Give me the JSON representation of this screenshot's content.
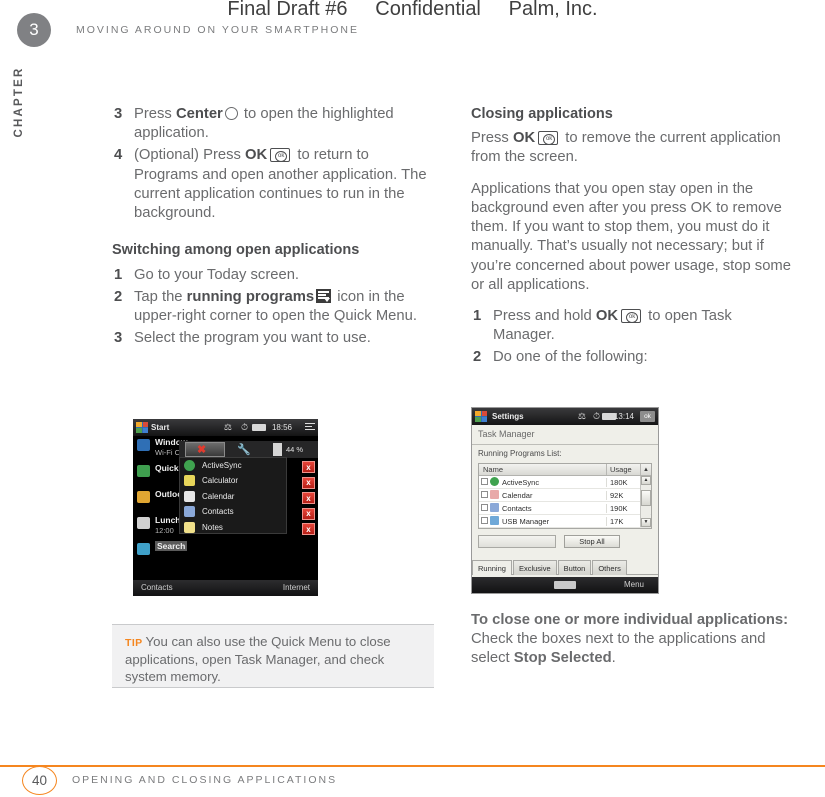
{
  "draft_header": "Final Draft #6     Confidential     Palm, Inc.",
  "chapter": {
    "number": "3",
    "word": "CHAPTER",
    "running_head": "MOVING AROUND ON YOUR SMARTPHONE"
  },
  "left_column": {
    "steps_top": [
      {
        "num": "3",
        "text_a": "Press ",
        "bold_a": "Center",
        "icon": "center-key-icon",
        "text_b": " to open the highlighted application."
      },
      {
        "num": "4",
        "text_a": "(Optional) Press ",
        "bold_a": "OK",
        "icon": "ok-key-icon",
        "text_b": " to return to Programs and open another application. The current application continues to run in the background."
      }
    ],
    "section_heading": "Switching among open applications",
    "steps_mid": [
      {
        "num": "1",
        "text": "Go to your Today screen."
      },
      {
        "num": "2",
        "text_a": "Tap the ",
        "bold_a": "running programs",
        "icon": "running-programs-icon",
        "text_b": " icon in the upper-right corner to open the Quick Menu."
      },
      {
        "num": "3",
        "text": "Select the program you want to use."
      }
    ],
    "tip": {
      "label": "TIP",
      "text": "You can also use the Quick Menu to close applications, open Task Manager, and check system memory."
    }
  },
  "right_column": {
    "section_heading": "Closing applications",
    "intro": {
      "text_a": "Press ",
      "bold_a": "OK",
      "icon": "ok-key-icon",
      "text_b": " to remove the current application from the screen."
    },
    "paragraph": "Applications that you open stay open in the background even after you press OK to remove them. If you want to stop them, you must do it manually. That’s usually not necessary; but if you’re concerned about power usage, stop some or all applications.",
    "steps": [
      {
        "num": "1",
        "text_a": "Press and hold ",
        "bold_a": "OK",
        "icon": "ok-key-icon",
        "text_b": " to open Task Manager."
      },
      {
        "num": "2",
        "text": "Do one of the following:"
      }
    ],
    "closing_note": {
      "bold_a": "To close one or more individual applications:",
      "text_a": " Check the boxes next to the applications and select ",
      "bold_b": "Stop Selected",
      "text_b": "."
    }
  },
  "screenshot_quickmenu": {
    "start_label": "Start",
    "clock": "18:56",
    "memory_percent": "44 %",
    "today_rows": [
      {
        "title": "Window",
        "subtitle": "Wi-Fi C"
      },
      {
        "title": "QuickS",
        "subtitle": ""
      },
      {
        "title": "Outloo",
        "subtitle": ""
      },
      {
        "title": "Lunch",
        "subtitle": "12:00"
      },
      {
        "title": "Search",
        "subtitle": ""
      }
    ],
    "menu_items": [
      "ActiveSync",
      "Calculator",
      "Calendar",
      "Contacts",
      "Notes"
    ],
    "close_buttons": [
      "x",
      "x",
      "x",
      "x",
      "x"
    ],
    "softkey_left": "Contacts",
    "softkey_right": "Internet"
  },
  "screenshot_taskmanager": {
    "titlebar": "Settings",
    "clock": "13:14",
    "ok_button": "ok",
    "page_title": "Task Manager",
    "list_label": "Running Programs List:",
    "columns": [
      "Name",
      "Usage"
    ],
    "rows": [
      {
        "name": "ActiveSync",
        "usage": "180K"
      },
      {
        "name": "Calendar",
        "usage": "92K"
      },
      {
        "name": "Contacts",
        "usage": "190K"
      },
      {
        "name": "USB Manager",
        "usage": "17K"
      }
    ],
    "stop_all_button": "Stop All",
    "tabs": [
      "Running",
      "Exclusive",
      "Button",
      "Others"
    ],
    "softkey_right": "Menu"
  },
  "footer": {
    "page_number": "40",
    "text": "OPENING AND CLOSING APPLICATIONS"
  },
  "colors": {
    "accent_orange": "#f5861f",
    "body_gray": "#6a6b6d",
    "heading_gray": "#4d4e50",
    "badge_gray": "#808184",
    "tip_bg": "#f1f1f2"
  }
}
